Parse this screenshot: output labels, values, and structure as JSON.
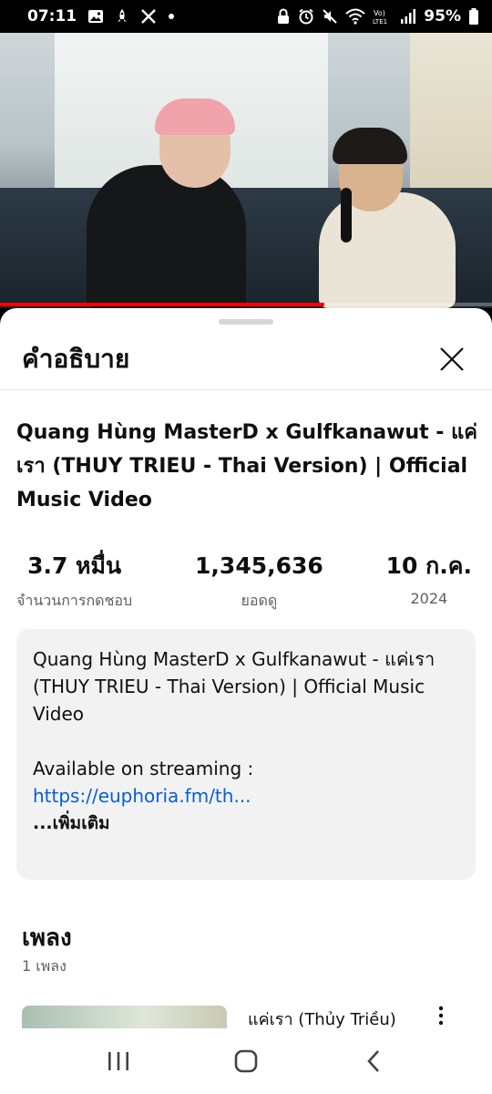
{
  "status_bar": {
    "time": "07:11",
    "battery": "95%",
    "left_icons": [
      "gallery-icon",
      "rocket-icon",
      "x-logo-icon",
      "dot-icon"
    ],
    "right_icons": [
      "lock-icon",
      "alarm-icon",
      "mute-icon",
      "wifi-icon",
      "volte-icon",
      "signal-icon",
      "battery-icon"
    ]
  },
  "video": {
    "progress": 0.66,
    "progress_color": "#ff0000"
  },
  "sheet": {
    "title": "คำอธิบาย",
    "video_title": "Quang Hùng MasterD x Gulfkanawut - แค่เรา (THUY TRIEU - Thai Version) | Official Music Video",
    "stats": [
      {
        "value": "3.7 หมื่น",
        "label": "จำนวนการกดชอบ"
      },
      {
        "value": "1,345,636",
        "label": "ยอดดู"
      },
      {
        "value": "10 ก.ค.",
        "label": "2024"
      }
    ],
    "description": {
      "text": "Quang Hùng MasterD x Gulfkanawut - แค่เรา (THUY TRIEU - Thai Version) | Official Music Video",
      "streaming_prefix": "Available on streaming : ",
      "link": "https://euphoria.fm/th...",
      "more": "...เพิ่มเติม"
    },
    "songs": {
      "heading": "เพลง",
      "count": "1 เพลง",
      "items": [
        {
          "title": "แค่เรา (Thủy Triều)"
        }
      ]
    }
  },
  "nav_bar": {
    "buttons": [
      "recent-apps-icon",
      "home-icon",
      "back-icon"
    ]
  },
  "colors": {
    "link": "#065fd4",
    "secondary_text": "#606060",
    "description_bg": "#f2f2f2"
  }
}
